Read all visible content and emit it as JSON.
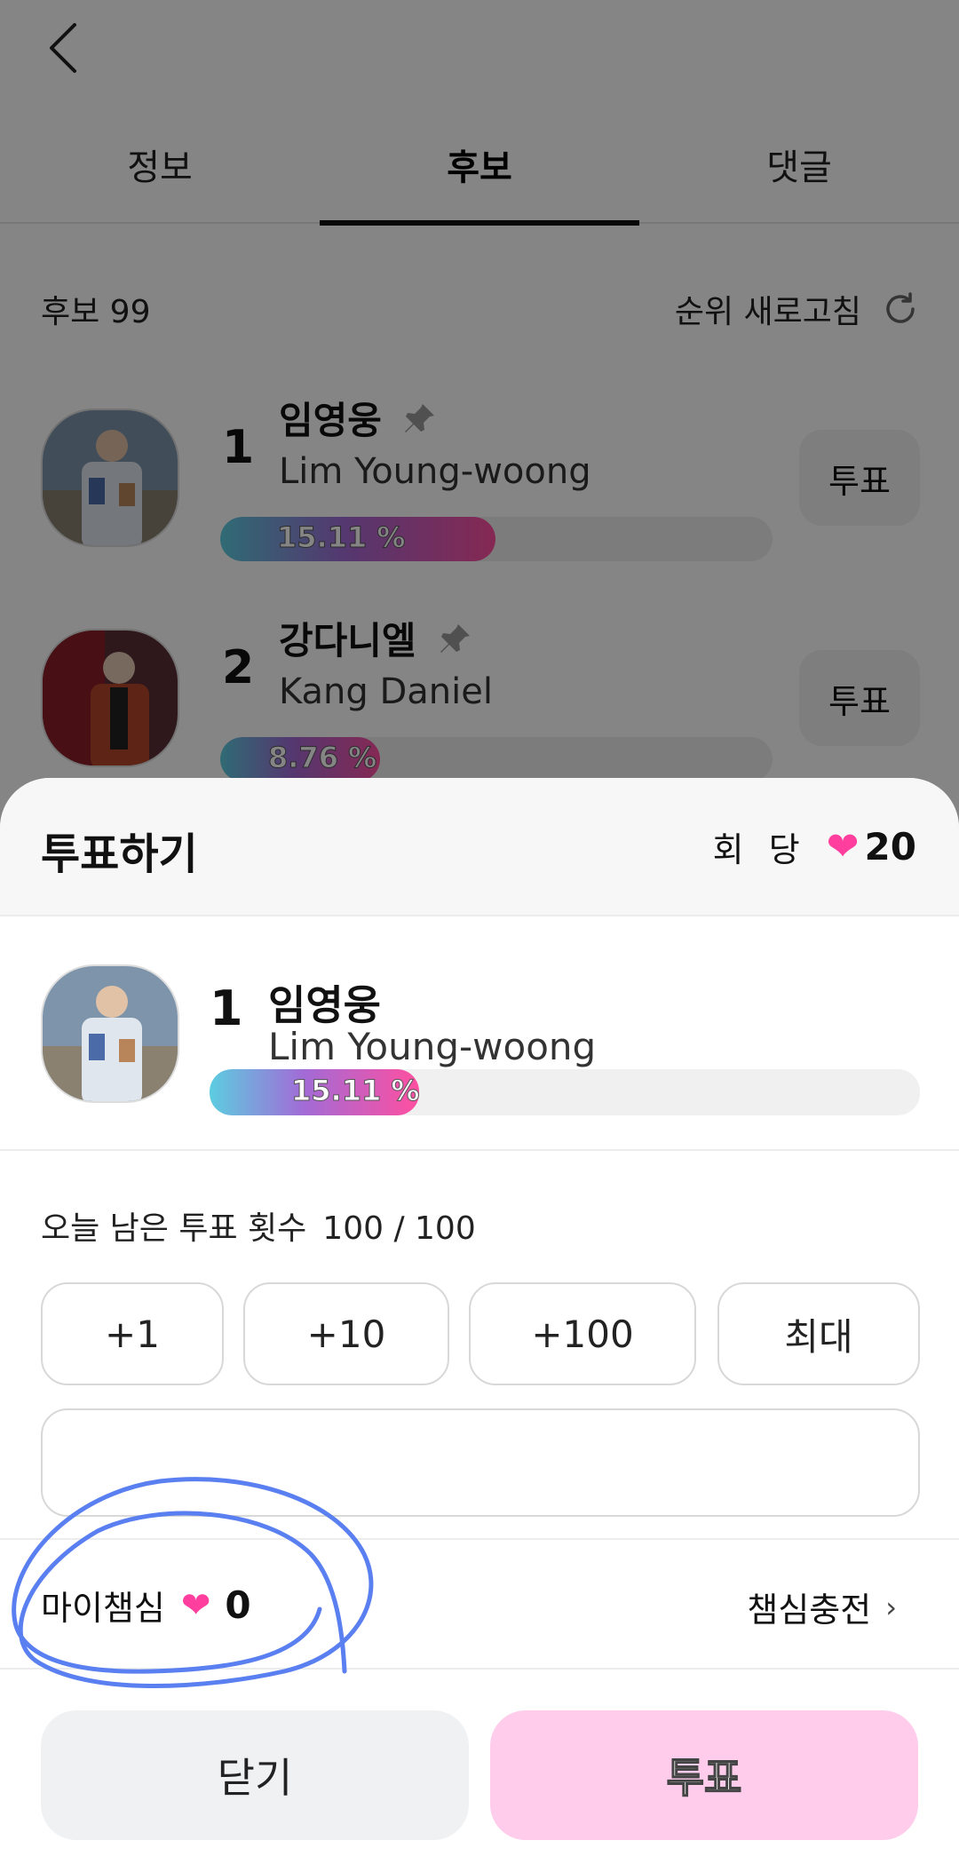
{
  "tabs": [
    {
      "label": "정보"
    },
    {
      "label": "후보"
    },
    {
      "label": "댓글"
    }
  ],
  "active_tab": 1,
  "candidates_header": {
    "count_label": "후보 99",
    "refresh_label": "순위 새로고침"
  },
  "candidates": [
    {
      "rank": "1",
      "name": "임영웅",
      "english_name": "Lim Young-woong",
      "percent_label": "15.11 %",
      "percent": 15.11,
      "vote_label": "투표"
    },
    {
      "rank": "2",
      "name": "강다니엘",
      "english_name": "Kang Daniel",
      "percent_label": "8.76 %",
      "percent": 8.76,
      "vote_label": "투표"
    }
  ],
  "sheet": {
    "title": "투표하기",
    "per_vote_label": "회 당",
    "per_vote_value": "20",
    "selected": {
      "rank": "1",
      "name": "임영웅",
      "english_name": "Lim Young-woong",
      "percent_label": "15.11 %",
      "percent": 15.11
    },
    "remaining_label": "오늘 남은 투표 횟수",
    "remaining_value": "100 / 100",
    "amount_buttons": [
      "+1",
      "+10",
      "+100",
      "최대"
    ],
    "vote_input_value": "",
    "my_hearts_label": "마이챔심",
    "my_hearts_value": "0",
    "charge_label": "챔심충전",
    "close_label": "닫기",
    "submit_label": "투표"
  },
  "colors": {
    "heart": "#ff3e9d",
    "submit_bg": "#ffccec",
    "annotation": "#5a7ff0"
  },
  "icons": [
    "back-arrow-icon",
    "refresh-icon",
    "pin-icon",
    "heart-icon",
    "chevron-right-icon"
  ]
}
